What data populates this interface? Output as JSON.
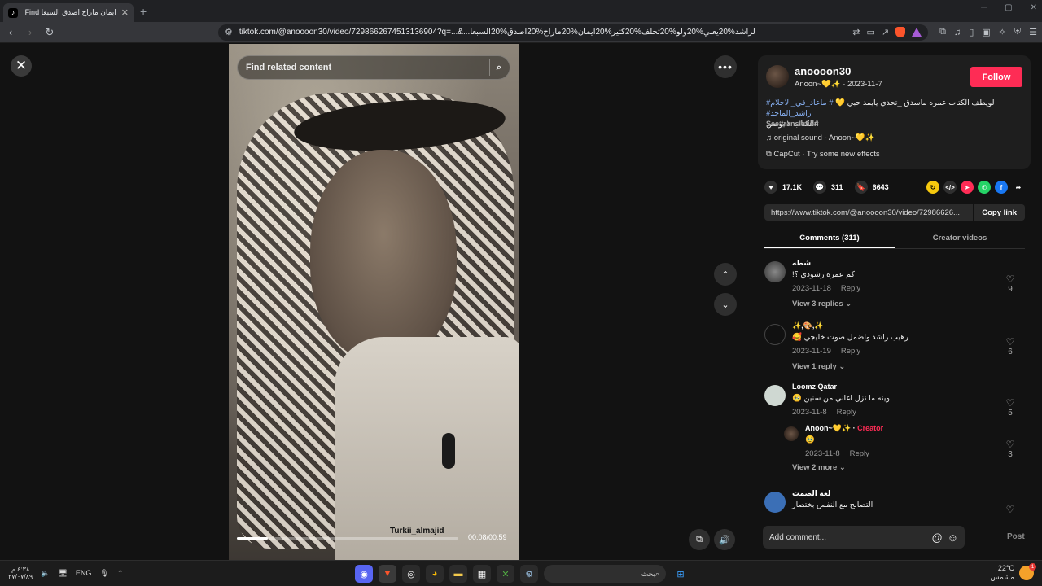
{
  "browser": {
    "tab_title": "ايمان ماراح اصدق السبعا Find",
    "new_tab_symbol": "+",
    "url": "tiktok.com/@anoooon30/video/7298662674513136904?q=...&...لراشد%20يعني%20ولو%20تحلف%20كثير%20ايمان%20ماراح%20اصدق%20السبعا",
    "close_symbol": "✕"
  },
  "video": {
    "search_placeholder": "Find related content",
    "watermark": "Turkii_almajid",
    "timecode": "00:08/00:59",
    "progress_fraction": 0.14
  },
  "author": {
    "username": "anoooon30",
    "subline": "Anoon~💛✨ · 2023-11-7",
    "follow_label": "Follow",
    "caption_text": "لويطف الكتاب عمره ماسدق _تحدي يايمد حبي 💛",
    "caption_hashtags": "# ماعاد_في_الاحلام# راشد_الماجد#",
    "caption_line2": "#الكتاب لا يؤتمن",
    "see_translation": "See translation",
    "sound": "♫  original sound - Anoon~💛✨",
    "effect": "⧉  CapCut · Try some new effects"
  },
  "stats": {
    "likes": "17.1K",
    "comments": "311",
    "saves": "6643"
  },
  "share": {
    "link": "https://www.tiktok.com/@anoooon30/video/72986626...",
    "copy_label": "Copy link"
  },
  "tabs": {
    "comments": "Comments (311)",
    "creator_videos": "Creator videos"
  },
  "comments": [
    {
      "name": "شطه",
      "text": "كم عمره رشودي ؟!",
      "date": "2023-11-18",
      "reply": "Reply",
      "likes": "9",
      "view_replies": "View 3 replies ⌄"
    },
    {
      "name": "✨,🎨,✨",
      "text": "رهيب راشد واضمل صوت خليجي 🥰",
      "date": "2023-11-19",
      "reply": "Reply",
      "likes": "6",
      "view_replies": "View 1 reply ⌄"
    },
    {
      "name": "Loomz Qatar",
      "text": "وينه ما نزل اغاني من سنين 🥹",
      "date": "2023-11-8",
      "reply": "Reply",
      "likes": "5",
      "view_replies": "View 2 more ⌄"
    },
    {
      "name": "Anoon~💛✨ ·",
      "creator": "Creator",
      "text": "🥹",
      "date": "2023-11-8",
      "reply": "Reply",
      "likes": "3"
    },
    {
      "name": "لغة الصمت",
      "text": "التصالح مع النفس بختصار",
      "date": "",
      "reply": "",
      "likes": ""
    }
  ],
  "comment_input": {
    "placeholder": "Add comment...",
    "post_label": "Post"
  },
  "taskbar": {
    "clock_time": "٤:٣٨ م",
    "clock_date": "٢٧/٠٧/٨٩",
    "lang": "ENG",
    "search_placeholder": "بحث",
    "temperature": "22°C",
    "weather": "مشمس",
    "notif_count": "1"
  }
}
